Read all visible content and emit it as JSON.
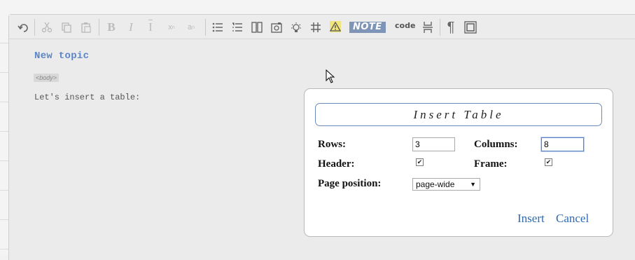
{
  "toolbar": {
    "buttons": [
      {
        "name": "undo-icon",
        "glyph": "↶",
        "enabled": true
      },
      {
        "name": "cut-icon",
        "glyph": "✂",
        "enabled": false
      },
      {
        "name": "copy-icon",
        "glyph": "⎘",
        "enabled": false
      },
      {
        "name": "paste-icon",
        "glyph": "📋",
        "enabled": false
      },
      {
        "name": "bold-icon",
        "glyph": "B",
        "enabled": false
      },
      {
        "name": "italic-icon",
        "glyph": "I",
        "enabled": false
      },
      {
        "name": "text-cursor-icon",
        "glyph": "I",
        "enabled": false
      },
      {
        "name": "superscript-icon",
        "glyph": "x",
        "enabled": false
      },
      {
        "name": "subscript-icon",
        "glyph": "a",
        "enabled": false
      },
      {
        "name": "bullet-list-icon",
        "glyph": "☰",
        "enabled": true
      },
      {
        "name": "numbered-list-icon",
        "glyph": "☷",
        "enabled": true
      },
      {
        "name": "columns-icon",
        "glyph": "▥",
        "enabled": true
      },
      {
        "name": "image-icon",
        "glyph": "▣",
        "enabled": true
      },
      {
        "name": "bulb-icon",
        "glyph": "☀",
        "enabled": true
      },
      {
        "name": "table-grid-icon",
        "glyph": "#",
        "enabled": true
      },
      {
        "name": "warning-icon",
        "glyph": "⚠",
        "enabled": true
      },
      {
        "name": "note-icon",
        "glyph": "NOTE",
        "enabled": true
      },
      {
        "name": "code-icon",
        "glyph": "code",
        "enabled": true
      },
      {
        "name": "page-break-icon",
        "glyph": "⇳",
        "enabled": true
      },
      {
        "name": "pilcrow-icon",
        "glyph": "¶",
        "enabled": true
      },
      {
        "name": "frame-icon",
        "glyph": "□",
        "enabled": true
      }
    ],
    "note_label": "NOTE",
    "code_label": "code"
  },
  "document": {
    "title": "New topic",
    "body_tag": "<body>",
    "paragraph": "Let's insert a table:"
  },
  "dialog": {
    "title": "Insert Table",
    "rows_label": "Rows:",
    "rows_value": "3",
    "columns_label": "Columns:",
    "columns_value": "8",
    "header_label": "Header:",
    "header_checked": true,
    "frame_label": "Frame:",
    "frame_checked": true,
    "position_label": "Page position:",
    "position_value": "page-wide",
    "insert_label": "Insert",
    "cancel_label": "Cancel"
  },
  "colors": {
    "link": "#2e6ab0",
    "title_blue": "#5b86c5",
    "note_bg": "#7f95b8",
    "warning_bg": "#f0e47a"
  }
}
